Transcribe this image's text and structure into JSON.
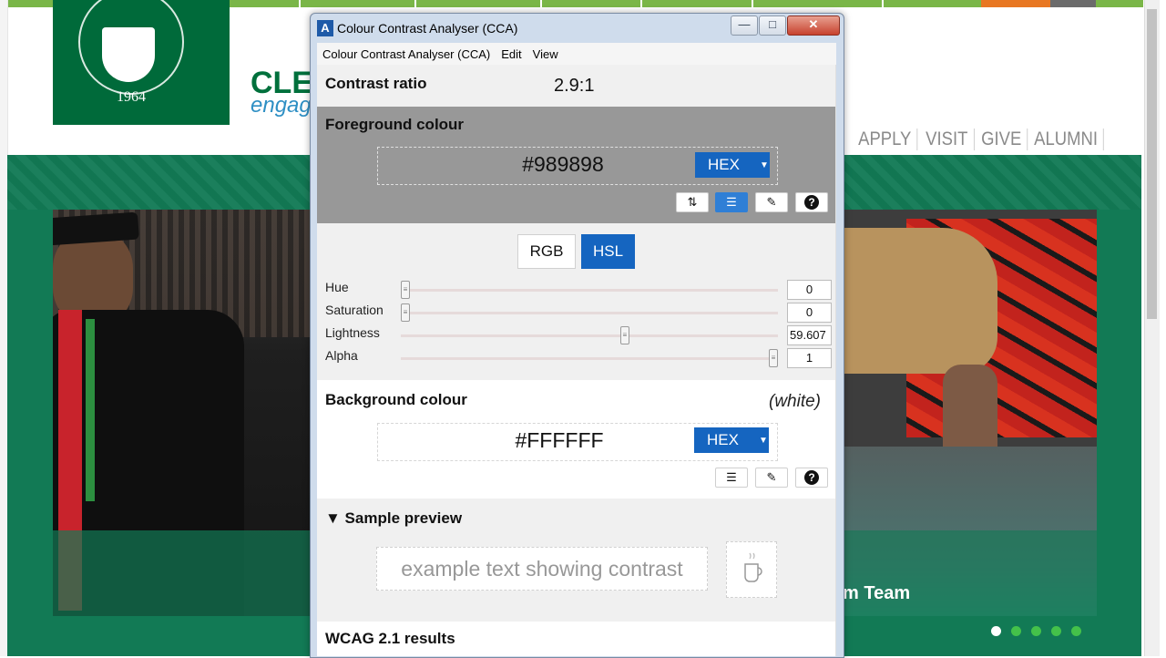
{
  "website": {
    "logo_year": "1964",
    "title_partial": "CLEV",
    "tagline_partial": "engag",
    "nav": [
      "APPLY",
      "VISIT",
      "GIVE",
      "ALUMNI"
    ],
    "right_caption": "m Team",
    "carousel_dots": 5,
    "active_dot": 0,
    "colors": {
      "brand_green": "#006a3a",
      "hero_green": "#127a55",
      "accent_orange": "#e87722",
      "bar_green": "#7ab648"
    }
  },
  "window": {
    "title": "Colour Contrast Analyser (CCA)",
    "menu": [
      "Colour Contrast Analyser (CCA)",
      "Edit",
      "View"
    ],
    "controls": [
      "minimize-icon",
      "maximize-icon",
      "close-icon"
    ]
  },
  "contrast": {
    "label": "Contrast ratio",
    "value": "2.9:1"
  },
  "foreground": {
    "label": "Foreground colour",
    "hex": "#989898",
    "format": "HEX",
    "tools": [
      "swap-icon",
      "sliders-icon",
      "eyedropper-icon",
      "help-icon"
    ],
    "active_tool": "sliders-icon"
  },
  "modes": {
    "rgb": "RGB",
    "hsl": "HSL",
    "active": "HSL"
  },
  "sliders": [
    {
      "label": "Hue",
      "value": "0",
      "fraction": 0.0
    },
    {
      "label": "Saturation",
      "value": "0",
      "fraction": 0.0
    },
    {
      "label": "Lightness",
      "value": "59.607",
      "fraction": 0.596
    },
    {
      "label": "Alpha",
      "value": "1",
      "fraction": 1.0
    }
  ],
  "background": {
    "label": "Background colour",
    "name": "(white)",
    "hex": "#FFFFFF",
    "format": "HEX",
    "tools": [
      "sliders-icon",
      "eyedropper-icon",
      "help-icon"
    ]
  },
  "preview": {
    "label": "▼ Sample preview",
    "sample_text": "example text showing contrast",
    "icon": "cup-icon"
  },
  "wcag": {
    "label": "WCAG 2.1 results"
  }
}
